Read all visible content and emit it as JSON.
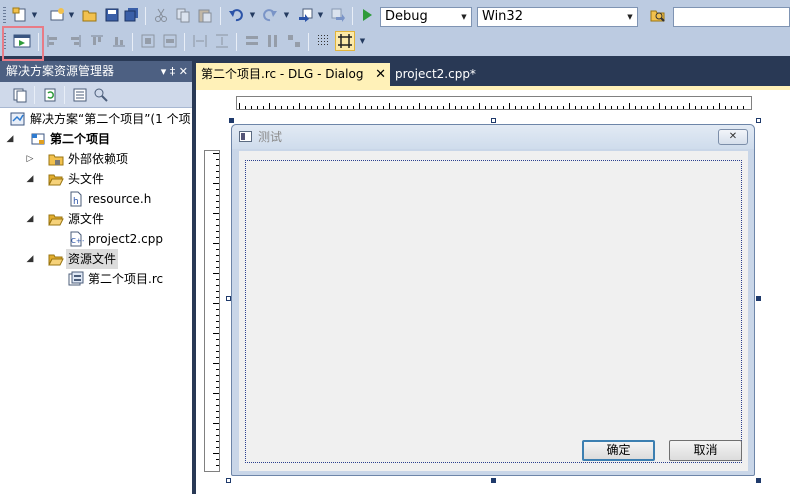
{
  "toolbar": {
    "config_combo": "Debug",
    "platform_combo": "Win32",
    "search_value": ""
  },
  "solution_explorer": {
    "title": "解决方案资源管理器",
    "pin_glyph": "▾ ‡ ✕",
    "tree": [
      {
        "label": "解决方案“第二个项目”(1 个项",
        "icon": "solution-icon",
        "bold": false
      },
      {
        "label": "第二个项目",
        "icon": "project-icon",
        "bold": true
      },
      {
        "label": "外部依赖项",
        "icon": "folder-icon",
        "bold": false
      },
      {
        "label": "头文件",
        "icon": "folder-open-icon",
        "bold": false
      },
      {
        "label": "resource.h",
        "icon": "header-file-icon",
        "bold": false
      },
      {
        "label": "源文件",
        "icon": "folder-open-icon",
        "bold": false
      },
      {
        "label": "project2.cpp",
        "icon": "cpp-file-icon",
        "bold": false
      },
      {
        "label": "资源文件",
        "icon": "folder-open-icon",
        "bold": false
      },
      {
        "label": "第二个项目.rc",
        "icon": "rc-file-icon",
        "bold": false
      }
    ]
  },
  "tabs": [
    {
      "label": "第二个项目.rc - DLG - Dialog",
      "active": true,
      "close": "✕"
    },
    {
      "label": "project2.cpp*",
      "active": false
    }
  ],
  "dialog": {
    "title": "测试",
    "close_glyph": "✕",
    "ok_label": "确定",
    "cancel_label": "取消"
  }
}
